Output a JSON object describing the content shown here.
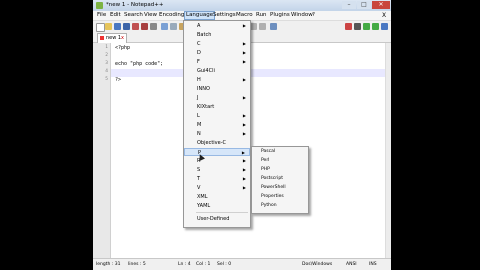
{
  "window": {
    "title": "*new  1 - Notepad++"
  },
  "window_buttons": {
    "minimize": "–",
    "maximize": "□",
    "close": "✕"
  },
  "menubar": {
    "items": [
      "File",
      "Edit",
      "Search",
      "View",
      "Encoding",
      "Language",
      "Settings",
      "Macro",
      "Run",
      "Plugins",
      "Window",
      "?"
    ],
    "active_index": 5,
    "close_glyph": "X"
  },
  "toolbar": {
    "icons": [
      "new-file-icon",
      "open-file-icon",
      "save-icon",
      "save-all-icon",
      "close-icon",
      "close-all-icon",
      "print-icon",
      "cut-icon",
      "copy-icon",
      "paste-icon",
      "undo-icon",
      "redo-icon",
      "find-icon",
      "replace-icon",
      "zoom-in-icon",
      "zoom-out-icon",
      "sync-v-icon",
      "sync-h-icon",
      "word-wrap-icon",
      "all-chars-icon",
      "indent-guide-icon",
      "udl-icon",
      "doc-map-icon",
      "function-list-icon",
      "folder-icon",
      "record-icon",
      "stop-icon",
      "play-icon",
      "run-macro-icon",
      "save-macro-icon"
    ]
  },
  "tab": {
    "label": "new  1",
    "close": "x"
  },
  "editor": {
    "lines": [
      {
        "num": "1",
        "text": "<?php"
      },
      {
        "num": "2",
        "text": ""
      },
      {
        "num": "3",
        "text": "echo \"php code\";"
      },
      {
        "num": "4",
        "text": ""
      },
      {
        "num": "5",
        "text": "?>"
      }
    ]
  },
  "language_menu": {
    "items": [
      {
        "label": "A",
        "submenu": true
      },
      {
        "label": "Batch",
        "submenu": false
      },
      {
        "label": "C",
        "submenu": true
      },
      {
        "label": "D",
        "submenu": true
      },
      {
        "label": "F",
        "submenu": true
      },
      {
        "label": "Gui4Cli",
        "submenu": false
      },
      {
        "label": "H",
        "submenu": true
      },
      {
        "label": "INNO",
        "submenu": false
      },
      {
        "label": "J",
        "submenu": true
      },
      {
        "label": "KIXtart",
        "submenu": false
      },
      {
        "label": "L",
        "submenu": true
      },
      {
        "label": "M",
        "submenu": true
      },
      {
        "label": "N",
        "submenu": true
      },
      {
        "label": "Objective-C",
        "submenu": false
      },
      {
        "label": "P",
        "submenu": true
      },
      {
        "label": "R",
        "submenu": true
      },
      {
        "label": "S",
        "submenu": true
      },
      {
        "label": "T",
        "submenu": true
      },
      {
        "label": "V",
        "submenu": true
      },
      {
        "label": "XML",
        "submenu": false
      },
      {
        "label": "YAML",
        "submenu": false
      },
      {
        "label": "User-Defined",
        "submenu": false
      }
    ],
    "hover_index": 14,
    "arrow_glyph": "▶"
  },
  "submenu_p": {
    "items": [
      "Pascal",
      "Perl",
      "PHP",
      "Postscript",
      "PowerShell",
      "Properties",
      "Python"
    ]
  },
  "statusbar": {
    "length": "length : 31",
    "lines": "lines : 5",
    "ln": "Ln : 4",
    "col": "Col : 1",
    "sel": "Sel : 0",
    "eol": "Dos\\Windows",
    "encoding": "ANSI",
    "mode": "INS"
  },
  "colors": {
    "menu_hover": "#d6e6f9",
    "close_button": "#c9463d",
    "current_line": "#e8e8ff"
  }
}
